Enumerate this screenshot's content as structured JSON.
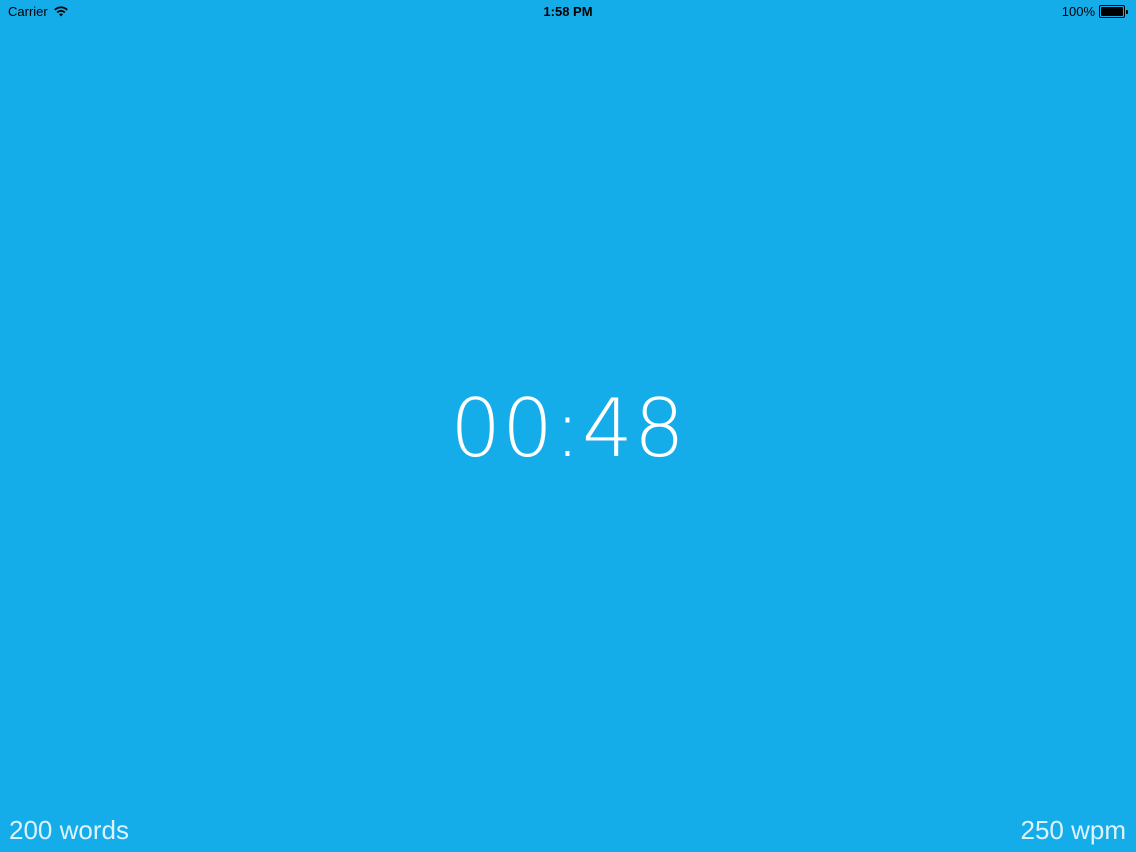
{
  "status_bar": {
    "carrier": "Carrier",
    "time": "1:58 PM",
    "battery_percent": "100%",
    "battery_level": 1.0,
    "wifi_icon": "wifi-icon",
    "battery_icon": "battery-icon"
  },
  "main": {
    "timer": "00:48"
  },
  "footer": {
    "word_count": "200 words",
    "reading_speed": "250 wpm"
  },
  "colors": {
    "background": "#15ACEA",
    "text": "#FFFFFF",
    "status_text": "#000000"
  }
}
